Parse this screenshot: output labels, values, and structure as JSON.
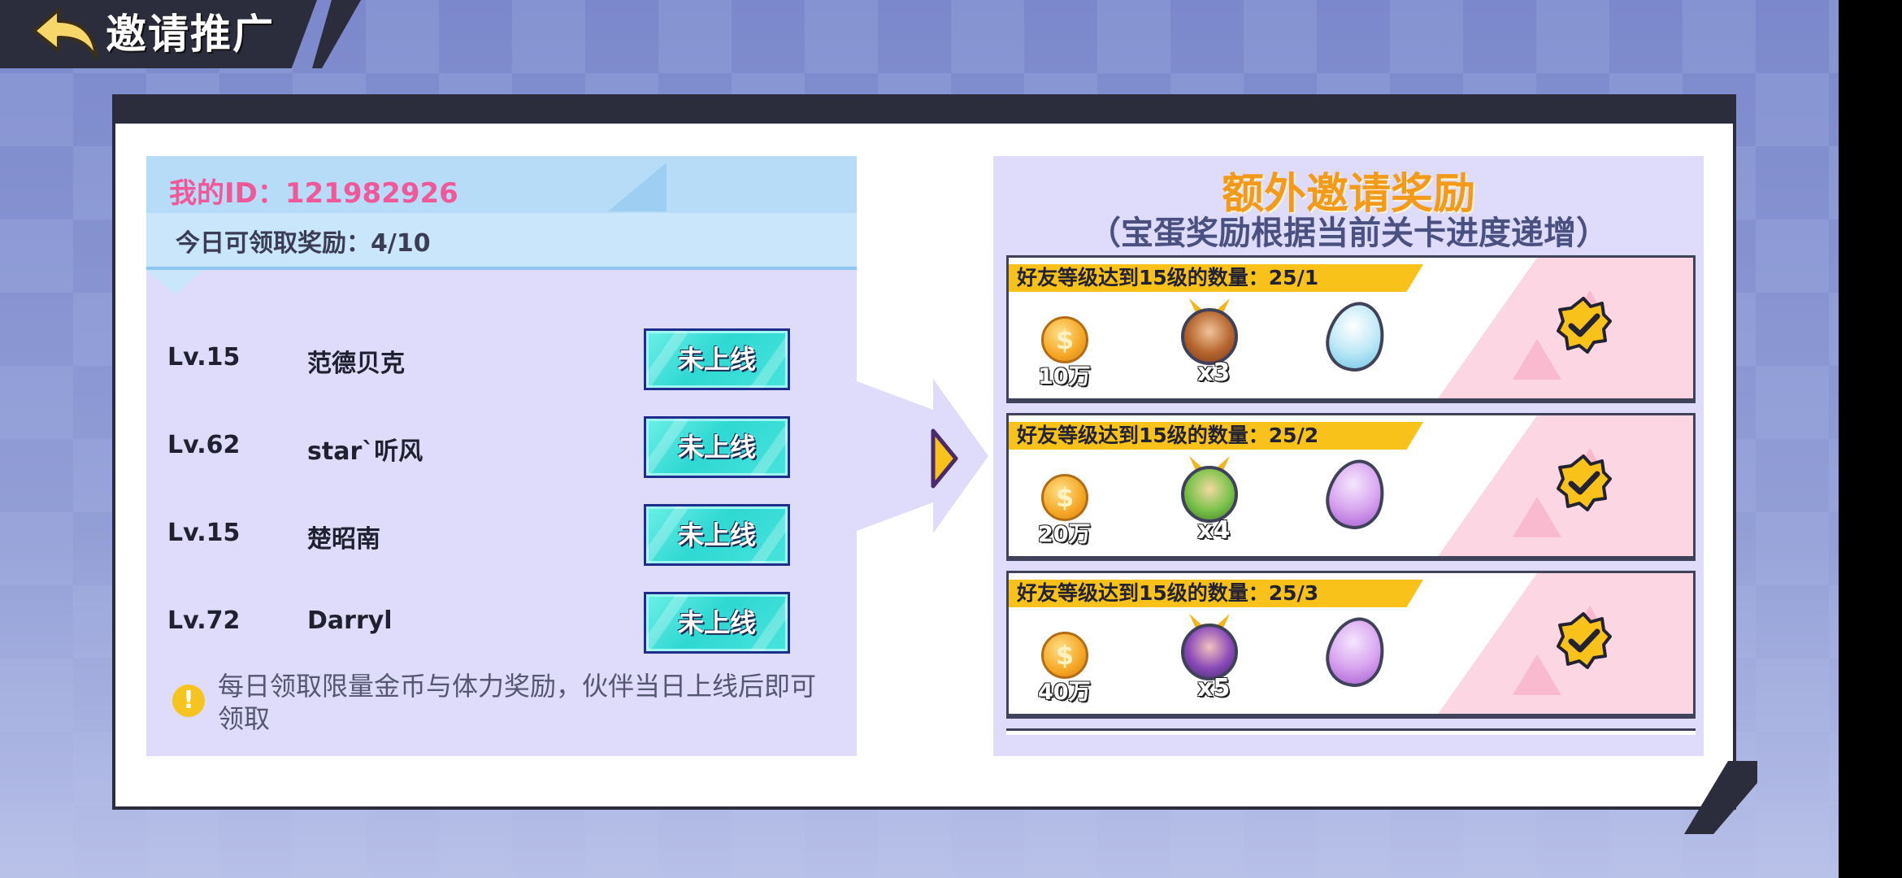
{
  "header": {
    "title": "邀请推广",
    "back_icon": "back-arrow-icon"
  },
  "left_panel": {
    "my_id": "我的ID：121982926",
    "today_reward": "今日可领取奖励：4/10",
    "friends": [
      {
        "level": "Lv.15",
        "name": "范德贝克",
        "status": "未上线"
      },
      {
        "level": "Lv.62",
        "name": "star`听风",
        "status": "未上线"
      },
      {
        "level": "Lv.15",
        "name": "楚昭南",
        "status": "未上线"
      },
      {
        "level": "Lv.72",
        "name": "Darryl",
        "status": "未上线"
      }
    ],
    "note": "每日领取限量金币与体力奖励，伙伴当日上线后即可领取"
  },
  "right_panel": {
    "title": "额外邀请奖励",
    "subtitle": "（宝蛋奖励根据当前关卡进度递增）",
    "rewards": [
      {
        "label": "好友等级达到15级的数量：25/1",
        "coin": "10万",
        "hero_count": "x3",
        "egg_color": "#bfe9f7",
        "claimed": true
      },
      {
        "label": "好友等级达到15级的数量：25/2",
        "coin": "20万",
        "hero_count": "x4",
        "egg_color": "#d9a6ef",
        "claimed": true
      },
      {
        "label": "好友等级达到15级的数量：25/3",
        "coin": "40万",
        "hero_count": "x5",
        "egg_color": "#d9a6ef",
        "claimed": true
      }
    ]
  },
  "colors": {
    "accent_pink": "#f0589a",
    "title_orange": "#f39a1a",
    "button_cyan": "#2fd8d2",
    "label_yellow": "#f8c21a",
    "panel_dark": "#2b2d3c"
  }
}
